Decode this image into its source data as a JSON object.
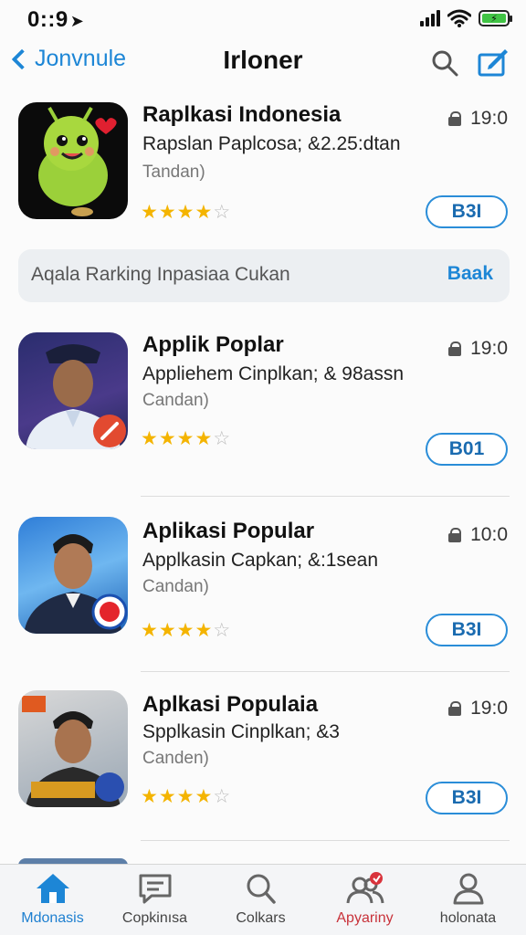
{
  "status_bar": {
    "time": "0::9",
    "location_glyph": "➤",
    "battery_glyph": "⚡"
  },
  "nav": {
    "back_label": "Jonvnule",
    "title": "Irloner"
  },
  "banner": {
    "text": "Aqala Rarking Inpasiaa Cukan",
    "action": "Baak"
  },
  "apps": [
    {
      "name": "Raplkasi Indonesia",
      "desc": "Rapslan Paplcosa; &2.25:dtan",
      "sub": "Tandan)",
      "time": "19:0",
      "rating": 4,
      "button": "B3I"
    },
    {
      "name": "Applik Poplar",
      "desc": "Appliehem Cinplkan; & 98assn",
      "sub": "Candan)",
      "time": "19:0",
      "rating": 4,
      "button": "B01"
    },
    {
      "name": "Aplikasi  Popular",
      "desc": "Applkasin Capkan; &:1sean",
      "sub": "Candan)",
      "time": "10:0",
      "rating": 4,
      "button": "B3I"
    },
    {
      "name": "Aplkasi Populaia",
      "desc": "Spplkasin Cinplkan; &3",
      "sub": "Canden)",
      "time": "19:0",
      "rating": 4,
      "button": "B3I"
    }
  ],
  "tabs": [
    {
      "label": "Mdonasis",
      "icon": "home-icon"
    },
    {
      "label": "Copkinısa",
      "icon": "chat-icon"
    },
    {
      "label": "Colkars",
      "icon": "search-icon"
    },
    {
      "label": "Apyariny",
      "icon": "people-icon"
    },
    {
      "label": "holonata",
      "icon": "profile-icon"
    }
  ],
  "colors": {
    "accent": "#1d86d6",
    "star": "#f4b400",
    "alert": "#c8323a"
  }
}
